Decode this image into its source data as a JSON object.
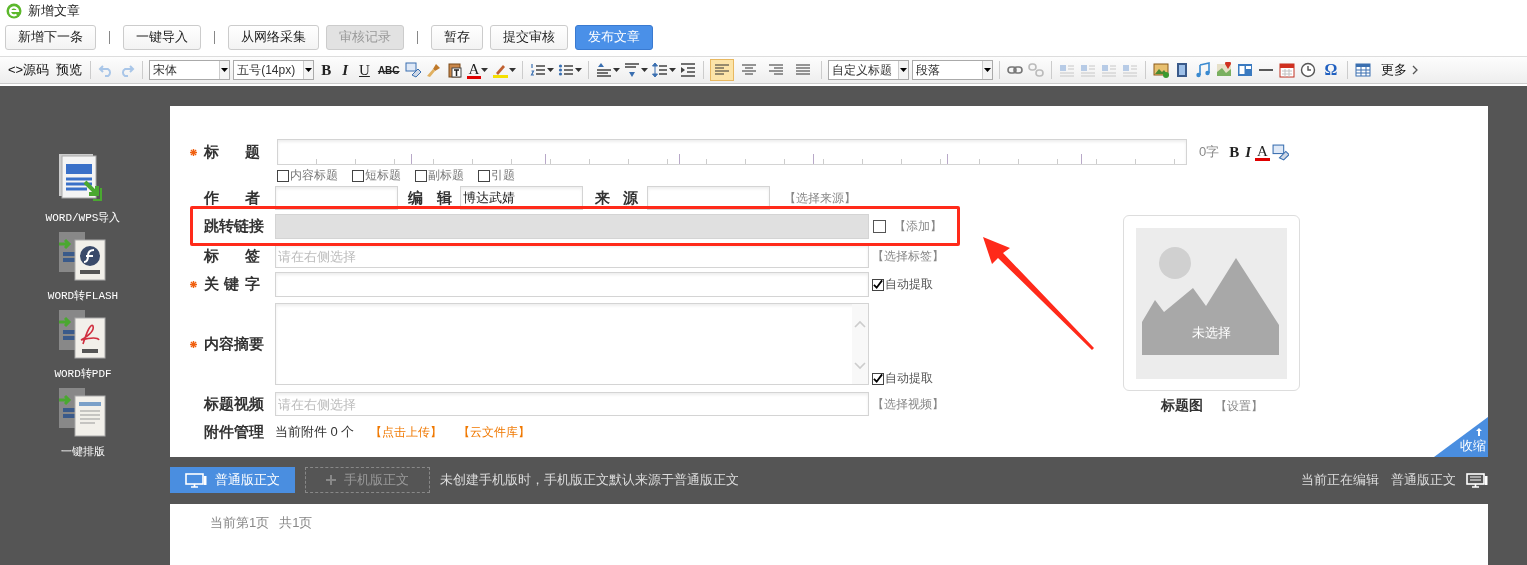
{
  "window": {
    "title": "新增文章"
  },
  "button_groups": [
    [
      {
        "label": "新增下一条",
        "kind": "normal"
      }
    ],
    [
      {
        "label": "一键导入",
        "kind": "normal"
      }
    ],
    [
      {
        "label": "从网络采集",
        "kind": "normal"
      },
      {
        "label": "审核记录",
        "kind": "disabled"
      }
    ],
    [
      {
        "label": "暂存",
        "kind": "normal"
      },
      {
        "label": "提交审核",
        "kind": "normal"
      },
      {
        "label": "发布文章",
        "kind": "primary"
      }
    ]
  ],
  "toolbar": {
    "source": "<>源码",
    "preview": "预览",
    "font": "宋体",
    "size": "五号(14px)",
    "bold": "B",
    "italic": "I",
    "underline": "U",
    "strike": "ABC",
    "font_color": "A",
    "alignments": [
      {
        "selected": true
      },
      {
        "selected": false
      },
      {
        "selected": false
      },
      {
        "selected": false
      }
    ],
    "heading": "自定义标题",
    "paragraph": "段落",
    "special_char": "Ω",
    "more": "更多"
  },
  "sidebar": {
    "items": [
      {
        "label": "WORD/WPS导入"
      },
      {
        "label": "WORD转FLASH"
      },
      {
        "label": "WORD转PDF"
      },
      {
        "label": "一键排版"
      }
    ]
  },
  "form": {
    "title": {
      "label": "标 题",
      "required": true,
      "count": "0字",
      "bold": "B",
      "italic": "I",
      "color_button": "A"
    },
    "title_options": [
      {
        "label": "内容标题",
        "checked": false
      },
      {
        "label": "短标题",
        "checked": false
      },
      {
        "label": "副标题",
        "checked": false
      },
      {
        "label": "引题",
        "checked": false
      }
    ],
    "author": {
      "label": "作 者",
      "required": false
    },
    "editor": {
      "label": "编 辑",
      "value": "博达武婧"
    },
    "source": {
      "label": "来 源",
      "link": "【选择来源】"
    },
    "jump_link": {
      "label": "跳转链接",
      "required": false,
      "disabled": true,
      "checked": false,
      "link": "【添加】"
    },
    "tags": {
      "label": "标 签",
      "required": false,
      "placeholder": "请在右侧选择",
      "link": "【选择标签】"
    },
    "keywords": {
      "label": "关 键 字",
      "required": true,
      "auto": {
        "label": "自动提取",
        "checked": true
      }
    },
    "summary": {
      "label": "内容摘要",
      "required": true,
      "auto": {
        "label": "自动提取",
        "checked": true
      }
    },
    "video": {
      "label": "标题视频",
      "required": false,
      "placeholder": "请在右侧选择",
      "link": "【选择视频】"
    },
    "attachments": {
      "label": "附件管理",
      "count": "当前附件 0 个",
      "upload": "【点击上传】",
      "library": "【云文件库】"
    }
  },
  "cover": {
    "empty_text": "未选择",
    "caption": "标题图",
    "link": "【设置】"
  },
  "collapse": "收缩",
  "body_tabs": [
    {
      "label": "普通版正文",
      "selected": true
    },
    {
      "label": "手机版正文",
      "selected": false
    }
  ],
  "body_note": "未创建手机版时，手机版正文默认来源于普通版正文",
  "editing_status": "当前正在编辑",
  "editing_mode": "普通版正文",
  "pager": {
    "current": "当前第1页",
    "total": "共1页"
  }
}
